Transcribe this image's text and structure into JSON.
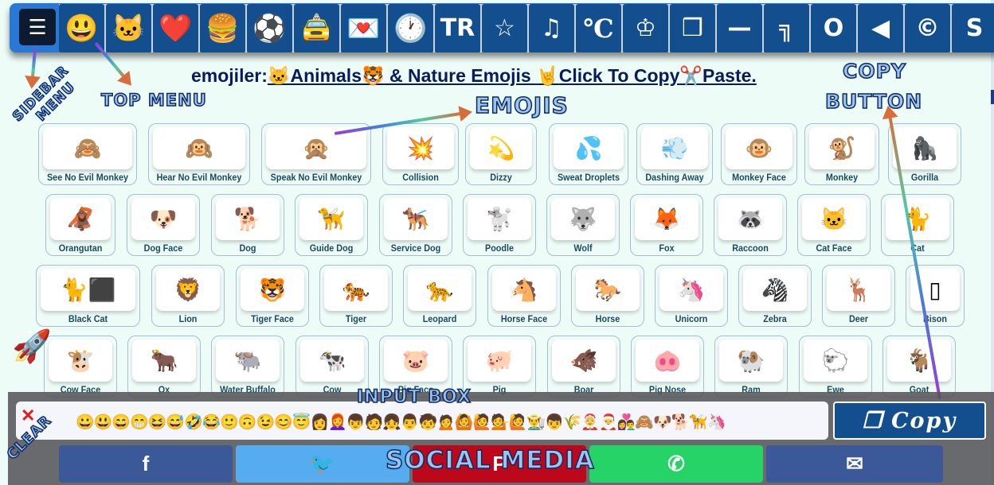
{
  "top_menu": {
    "hamburger_icon": "menu-icon",
    "items": [
      {
        "name": "smileys",
        "glyph": "😃",
        "class": ""
      },
      {
        "name": "animals",
        "glyph": "🐱",
        "class": ""
      },
      {
        "name": "heart",
        "glyph": "❤️",
        "class": ""
      },
      {
        "name": "food",
        "glyph": "🍔",
        "class": ""
      },
      {
        "name": "activity",
        "glyph": "⚽",
        "class": ""
      },
      {
        "name": "travel",
        "glyph": "🚖",
        "class": ""
      },
      {
        "name": "objects",
        "glyph": "💌",
        "class": ""
      },
      {
        "name": "clock",
        "glyph": "🕐",
        "class": ""
      },
      {
        "name": "flags",
        "glyph": "TR",
        "class": "txt"
      },
      {
        "name": "star",
        "glyph": "☆",
        "class": "txt"
      },
      {
        "name": "music",
        "glyph": "♫",
        "class": "txt"
      },
      {
        "name": "celsius",
        "glyph": "℃",
        "class": "serif"
      },
      {
        "name": "chess",
        "glyph": "♔",
        "class": "txt"
      },
      {
        "name": "box",
        "glyph": "❒",
        "class": "txt"
      },
      {
        "name": "line",
        "glyph": "—",
        "class": "txt"
      },
      {
        "name": "corner",
        "glyph": "╗",
        "class": "txt"
      },
      {
        "name": "circle",
        "glyph": "O",
        "class": "txt"
      },
      {
        "name": "triangle",
        "glyph": "◀",
        "class": "txt"
      },
      {
        "name": "copyright",
        "glyph": "©",
        "class": "txt"
      },
      {
        "name": "more",
        "glyph": "S",
        "class": "txt"
      }
    ]
  },
  "header": {
    "prefix": "emojiler:",
    "cat_emoji": "🐱",
    "link1": "Animals",
    "tiger_emoji": "🐯",
    "link2": " & Nature Emojis ",
    "horns_emoji": "🤘",
    "link3": "Click To Copy",
    "scissors_emoji": "✂️",
    "link4": "Paste."
  },
  "annotations": {
    "sidebar": "SIDEBAR",
    "menu": "MENU",
    "top_menu": "TOP MENU",
    "emojis": "EMOJIS",
    "copy": "COPY",
    "button": "BUTTON",
    "input_box": "INPUT BOX",
    "clear": "CLEAR",
    "social_media": "SOCIAL MEDIA"
  },
  "emoji_rows": [
    [
      {
        "e": "🙈",
        "label": "See No Evil Monkey"
      },
      {
        "e": "🙉",
        "label": "Hear No Evil Monkey"
      },
      {
        "e": "🙊",
        "label": "Speak No Evil Monkey"
      },
      {
        "e": "💥",
        "label": "Collision"
      },
      {
        "e": "💫",
        "label": "Dizzy"
      },
      {
        "e": "💦",
        "label": "Sweat Droplets"
      },
      {
        "e": "💨",
        "label": "Dashing Away"
      },
      {
        "e": "🐵",
        "label": "Monkey Face"
      },
      {
        "e": "🐒",
        "label": "Monkey"
      },
      {
        "e": "🦍",
        "label": "Gorilla"
      }
    ],
    [
      {
        "e": "🦧",
        "label": "Orangutan"
      },
      {
        "e": "🐶",
        "label": "Dog Face"
      },
      {
        "e": "🐕",
        "label": "Dog"
      },
      {
        "e": "🦮",
        "label": "Guide Dog"
      },
      {
        "e": "🐕‍🦺",
        "label": "Service Dog"
      },
      {
        "e": "🐩",
        "label": "Poodle"
      },
      {
        "e": "🐺",
        "label": "Wolf"
      },
      {
        "e": "🦊",
        "label": "Fox"
      },
      {
        "e": "🦝",
        "label": "Raccoon"
      },
      {
        "e": "🐱",
        "label": "Cat Face"
      },
      {
        "e": "🐈",
        "label": "Cat"
      }
    ],
    [
      {
        "e": "🐈⬛",
        "label": "Black Cat"
      },
      {
        "e": "🦁",
        "label": "Lion"
      },
      {
        "e": "🐯",
        "label": "Tiger Face"
      },
      {
        "e": "🐅",
        "label": "Tiger"
      },
      {
        "e": "🐆",
        "label": "Leopard"
      },
      {
        "e": "🐴",
        "label": "Horse Face"
      },
      {
        "e": "🐎",
        "label": "Horse"
      },
      {
        "e": "🦄",
        "label": "Unicorn"
      },
      {
        "e": "🦓",
        "label": "Zebra"
      },
      {
        "e": "🦌",
        "label": "Deer"
      },
      {
        "e": "▯",
        "label": "Bison"
      }
    ],
    [
      {
        "e": "🐮",
        "label": "Cow Face"
      },
      {
        "e": "🐂",
        "label": "Ox"
      },
      {
        "e": "🐃",
        "label": "Water Buffalo"
      },
      {
        "e": "🐄",
        "label": "Cow"
      },
      {
        "e": "🐷",
        "label": "Pig Face"
      },
      {
        "e": "🐖",
        "label": "Pig"
      },
      {
        "e": "🐗",
        "label": "Boar"
      },
      {
        "e": "🐽",
        "label": "Pig Nose"
      },
      {
        "e": "🐏",
        "label": "Ram"
      },
      {
        "e": "🐑",
        "label": "Ewe"
      },
      {
        "e": "🐐",
        "label": "Goat"
      }
    ]
  ],
  "input_box": {
    "value": "😀😃😄😁😆😅🤣😂🙂🙃😉😊😇👩👩‍🦰👦🧑👧👨🧒🙍🙆🙋💁🙋👨‍🌾👦🌾🤶🎅👩‍❤️‍👨🙈🐶🐕🦮🦄",
    "clear_label": "✕"
  },
  "copy_button": {
    "label": "Copy",
    "icon": "copy-icon"
  },
  "social": [
    {
      "name": "facebook",
      "glyph": "f",
      "color": "#3b5998"
    },
    {
      "name": "twitter",
      "glyph": "🐦",
      "color": "#55acee"
    },
    {
      "name": "pinterest",
      "glyph": "P",
      "color": "#bd081c"
    },
    {
      "name": "whatsapp",
      "glyph": "✆",
      "color": "#25d366"
    },
    {
      "name": "email",
      "glyph": "✉",
      "color": "#3b5998"
    }
  ],
  "rocket": "🚀"
}
